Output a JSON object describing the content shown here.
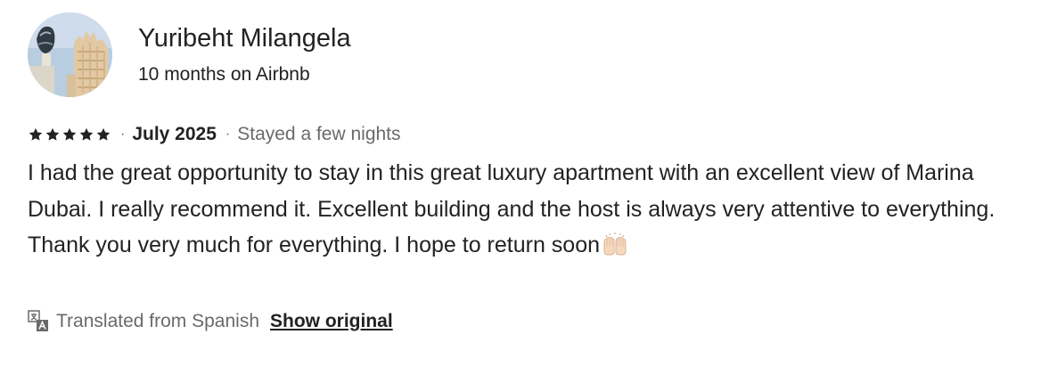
{
  "reviewer": {
    "name": "Yuribeht Milangela",
    "tenure": "10 months on Airbnb"
  },
  "review": {
    "rating": 5,
    "star_color": "#222222",
    "separator": "·",
    "date": "July 2025",
    "stay_type": "Stayed a few nights",
    "text": "I had the great opportunity to stay in this great luxury apartment with an excellent view of Marina Dubai. I really recommend it. Excellent building and the host is always very attentive to everything. Thank you very much for everything. I hope to return soon",
    "emoji": "raising-hands"
  },
  "translation": {
    "note": "Translated from Spanish",
    "show_original_label": "Show original"
  },
  "icons": {
    "star": "star-icon",
    "translate": "translate-icon"
  }
}
